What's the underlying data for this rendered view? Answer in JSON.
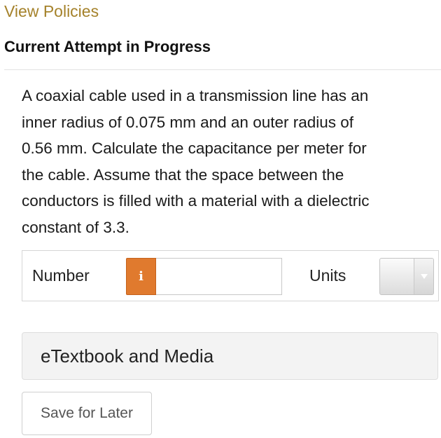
{
  "header": {
    "view_policies_link": "View Policies",
    "attempt_title": "Current Attempt in Progress"
  },
  "question": {
    "lines": [
      "A coaxial cable used in a transmission line has an",
      "inner radius of 0.075 mm and an outer radius of",
      "0.56 mm. Calculate the capacitance per meter for",
      "the cable. Assume that the space between the",
      "conductors is filled with a material with a dielectric",
      "constant of 3.3."
    ]
  },
  "answer": {
    "number_label": "Number",
    "info_icon": "info-icon",
    "info_glyph": "i",
    "number_value": "",
    "units_label": "Units",
    "units_selected": "",
    "dropdown_icon": "chevron-down-icon"
  },
  "resources": {
    "etextbook_label": "eTextbook and Media"
  },
  "actions": {
    "save_label": "Save for Later"
  },
  "colors": {
    "link": "#a5822b",
    "info_button": "#e07a2e",
    "panel_background": "#f3f3f3"
  }
}
